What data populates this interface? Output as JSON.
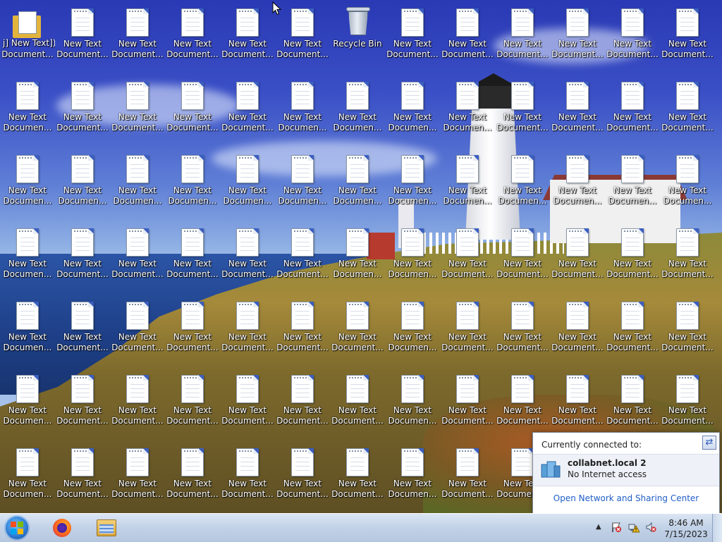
{
  "desktop": {
    "doc_label": "New Text\nDocument...",
    "doc_label_trunc": "New Text\nDocumen...",
    "broken_label": "j] New Text])",
    "broken_label_2": "Document...",
    "recycle_bin_label": "Recycle Bin",
    "cols": 13,
    "rows": 7
  },
  "network_popup": {
    "header": "Currently connected to:",
    "network_name": "collabnet.local  2",
    "network_status": "No Internet access",
    "link": "Open Network and Sharing Center"
  },
  "taskbar": {
    "start_icon": "windows-start-orb",
    "apps": [
      "firefox-icon",
      "windows-explorer-icon"
    ],
    "tray_icons": [
      "action-center-flag-icon",
      "network-warning-icon",
      "volume-muted-icon"
    ],
    "time": "8:46 AM",
    "date": "7/15/2023",
    "colors": {
      "taskbar": "#c3d3e8",
      "accent": "#2c77cf",
      "link": "#1f5ec8"
    }
  }
}
